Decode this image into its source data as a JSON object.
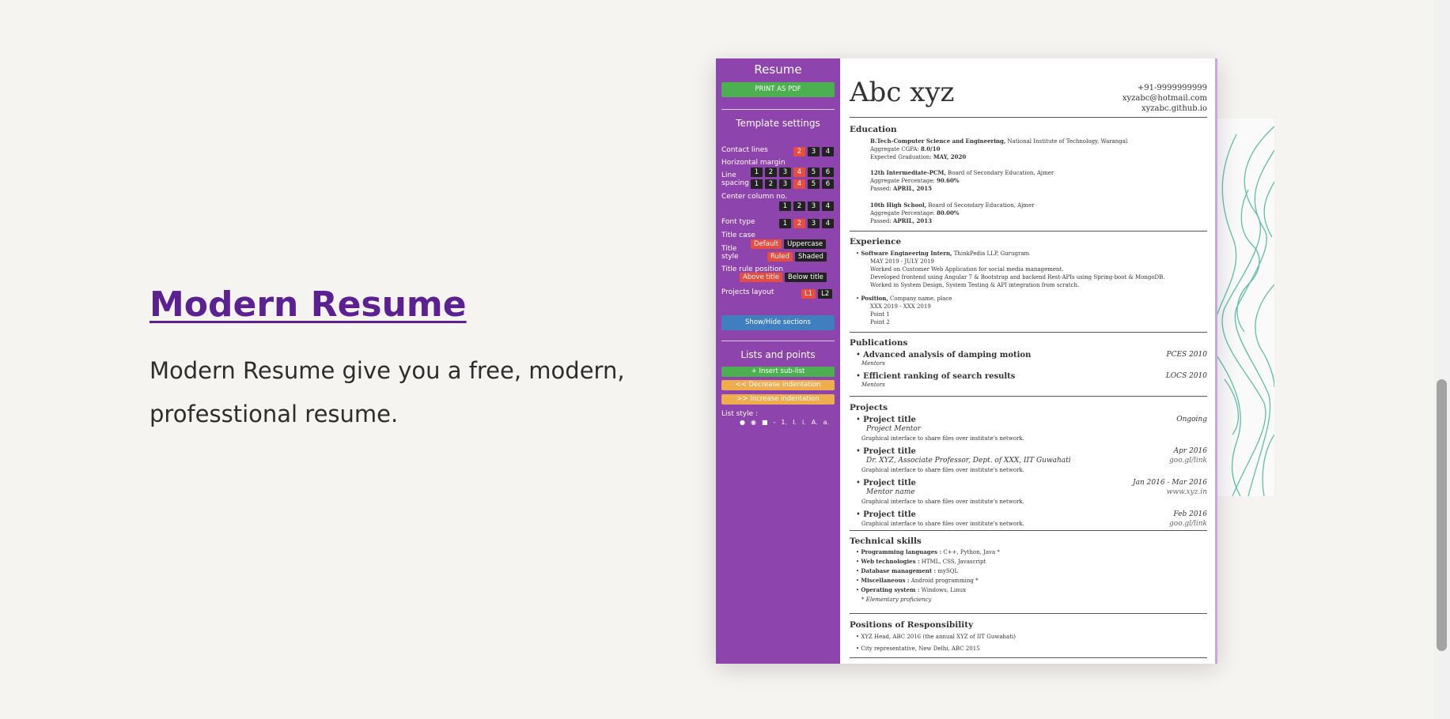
{
  "project": {
    "title": "Modern Resume",
    "description": "Modern Resume give you a free, modern, professtional resume."
  },
  "sidebar": {
    "title": "Resume",
    "print_button": "PRINT AS PDF",
    "template_settings_title": "Template settings",
    "contact_lines": {
      "label": "Contact lines",
      "options": [
        "2",
        "3",
        "4"
      ],
      "selected": "2"
    },
    "horizontal_margin": {
      "label": "Horizontal margin"
    },
    "line_spacing": {
      "label": "Line spacing",
      "row1": [
        "1",
        "2",
        "3",
        "4",
        "5",
        "6"
      ],
      "row2": [
        "1",
        "2",
        "3",
        "4",
        "5",
        "6"
      ],
      "selected": "4"
    },
    "center_column": {
      "label": "Center column no.",
      "options": [
        "1",
        "2",
        "3",
        "4"
      ]
    },
    "font_type": {
      "label": "Font type",
      "options": [
        "1",
        "2",
        "3",
        "4"
      ],
      "selected": "2"
    },
    "title_case": {
      "label": "Title case",
      "options": [
        "Default",
        "Uppercase"
      ],
      "selected": "Default"
    },
    "title_style": {
      "label": "Title style",
      "options": [
        "Ruled",
        "Shaded"
      ],
      "selected": "Ruled"
    },
    "title_rule_position": {
      "label": "Title rule position",
      "options": [
        "Above title",
        "Below title"
      ],
      "selected": "Above title"
    },
    "projects_layout": {
      "label": "Projects layout",
      "options": [
        "L1",
        "L2"
      ],
      "selected": "L1"
    },
    "show_hide_button": "Show/Hide sections",
    "lists_title": "Lists and points",
    "insert_sublist": "+ Insert sub-list",
    "decrease_indent": "<< Decrease indentation",
    "increase_indent": ">> Increase indentation",
    "list_style_label": "List style :",
    "list_styles": [
      "●",
      "◉",
      "■",
      "-",
      "1.",
      "I.",
      "i.",
      "A.",
      "a."
    ]
  },
  "resume": {
    "name": "Abc xyz",
    "contact": [
      "+91-9999999999",
      "xyzabc@hotmail.com",
      "xyzabc.github.io"
    ],
    "education": {
      "title": "Education",
      "entries": [
        {
          "degree": "B.Tech-Computer Science and Engineering,",
          "school": "National Institute of Technology, Warangal",
          "l2_label": "Aggregate CGPA: ",
          "l2_value": "8.0/10",
          "l3_label": "Expected Graduation: ",
          "l3_value": "MAY, 2020"
        },
        {
          "degree": "12th Intermediate-PCM,",
          "school": "Board of Secondary Education, Ajmer",
          "l2_label": "Aggregate Percentage: ",
          "l2_value": "90.60%",
          "l3_label": "Passed: ",
          "l3_value": "APRIL, 2015"
        },
        {
          "degree": "10th High School,",
          "school": "Board of Secondary Education, Ajmer",
          "l2_label": "Aggregate Percentage: ",
          "l2_value": "80.00%",
          "l3_label": "Passed: ",
          "l3_value": "APRIL, 2013"
        }
      ]
    },
    "experience": {
      "title": "Experience",
      "job1": {
        "role": "Software Engineering Intern,",
        "company": "ThinkPedia LLP, Gurugram",
        "dates": "MAY 2019 - JULY 2019",
        "lines": [
          "Worked on Customer Web Application for social media management.",
          "Developed frontend using Angular 7 & Bootstrap and backend Rest-APIs using Spring-boot & MongoDB.",
          "Worked in System Design, System Testing & API integration from scratch."
        ]
      },
      "job2": {
        "role": "Position,",
        "company": "Company name, place",
        "dates": "XXX 2019 - XXX 2019",
        "lines": [
          "Point 1",
          "Point 2"
        ]
      }
    },
    "publications": {
      "title": "Publications",
      "items": [
        {
          "title": "Advanced analysis of damping motion",
          "venue": "PCES 2010",
          "mentors": "Mentors"
        },
        {
          "title": "Efficient ranking of search results",
          "venue": "LOCS 2010",
          "mentors": "Mentors"
        }
      ]
    },
    "projects": {
      "title": "Projects",
      "items": [
        {
          "title": "Project title",
          "date": "Ongoing",
          "sub": "Project Mentor",
          "link": "",
          "desc": "Graphical interface to share files over institute's network."
        },
        {
          "title": "Project title",
          "date": "Apr 2016",
          "sub": "Dr. XYZ, Associate Professor, Dept. of XXX, IIT Guwahati",
          "link": "goo.gl/link",
          "desc": "Graphical interface to share files over institute's network."
        },
        {
          "title": "Project title",
          "date": "Jan 2016 - Mar 2016",
          "sub": "Mentor name",
          "link": "www.xyz.in",
          "desc": "Graphical interface to share files over institute's network."
        },
        {
          "title": "Project title",
          "date": "Feb 2016",
          "sub": "",
          "link": "goo.gl/link",
          "desc": "Graphical interface to share files over institute's network."
        }
      ]
    },
    "skills": {
      "title": "Technical skills",
      "items": [
        {
          "label": "Programming languages :",
          "value": "C++, Python, Java *"
        },
        {
          "label": "Web technologies :",
          "value": "HTML, CSS, Javascript"
        },
        {
          "label": "Database management :",
          "value": "mySQL"
        },
        {
          "label": "Miscellaneous :",
          "value": "Android programming *"
        },
        {
          "label": "Operating system :",
          "value": "Windows, Linux"
        }
      ],
      "note": "* Elementary proficiency"
    },
    "positions": {
      "title": "Positions of Responsibility",
      "items": [
        "XYZ Head, ABC 2016 (the annual XYZ of IIT Guwahati)",
        "City representative, New Delhi, ABC 2015"
      ]
    }
  },
  "colors": {
    "sidebar": "#8e44ad",
    "accent_red": "#e74c3c",
    "green": "#4caf50",
    "blue": "#3f7fc0",
    "orange": "#f0ad4e",
    "title": "#5b2091"
  }
}
